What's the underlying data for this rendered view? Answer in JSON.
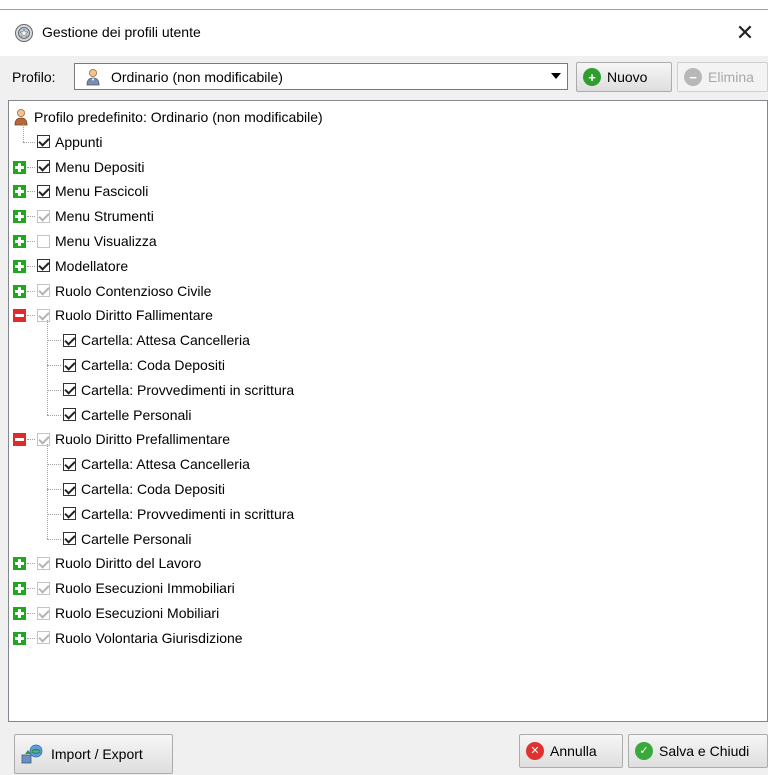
{
  "window": {
    "title": "Gestione dei profili utente",
    "close_glyph": "✕"
  },
  "toolbar": {
    "profile_label": "Profilo:",
    "selected_profile": "Ordinario (non modificabile)",
    "new_label": "Nuovo",
    "delete_label": "Elimina"
  },
  "tree": {
    "root_label": "Profilo predefinito: Ordinario (non modificabile)",
    "items": [
      {
        "label": "Appunti",
        "checked": true,
        "enabled": true,
        "expander": "none"
      },
      {
        "label": "Menu Depositi",
        "checked": true,
        "enabled": true,
        "expander": "plus"
      },
      {
        "label": "Menu Fascicoli",
        "checked": true,
        "enabled": true,
        "expander": "plus"
      },
      {
        "label": "Menu Strumenti",
        "checked": true,
        "enabled": false,
        "expander": "plus"
      },
      {
        "label": "Menu Visualizza",
        "checked": false,
        "enabled": false,
        "expander": "plus"
      },
      {
        "label": "Modellatore",
        "checked": true,
        "enabled": true,
        "expander": "plus"
      },
      {
        "label": "Ruolo Contenzioso Civile",
        "checked": true,
        "enabled": false,
        "expander": "plus"
      },
      {
        "label": "Ruolo Diritto Fallimentare",
        "checked": true,
        "enabled": false,
        "expander": "minus",
        "children": [
          {
            "label": "Cartella: Attesa Cancelleria",
            "checked": true,
            "enabled": true
          },
          {
            "label": "Cartella: Coda Depositi",
            "checked": true,
            "enabled": true
          },
          {
            "label": "Cartella: Provvedimenti in scrittura",
            "checked": true,
            "enabled": true
          },
          {
            "label": "Cartelle Personali",
            "checked": true,
            "enabled": true
          }
        ]
      },
      {
        "label": "Ruolo Diritto Prefallimentare",
        "checked": true,
        "enabled": false,
        "expander": "minus",
        "children": [
          {
            "label": "Cartella: Attesa Cancelleria",
            "checked": true,
            "enabled": true
          },
          {
            "label": "Cartella: Coda Depositi",
            "checked": true,
            "enabled": true
          },
          {
            "label": "Cartella: Provvedimenti in scrittura",
            "checked": true,
            "enabled": true
          },
          {
            "label": "Cartelle Personali",
            "checked": true,
            "enabled": true
          }
        ]
      },
      {
        "label": "Ruolo Diritto del Lavoro",
        "checked": true,
        "enabled": false,
        "expander": "plus"
      },
      {
        "label": "Ruolo Esecuzioni Immobiliari",
        "checked": true,
        "enabled": false,
        "expander": "plus"
      },
      {
        "label": "Ruolo Esecuzioni Mobiliari",
        "checked": true,
        "enabled": false,
        "expander": "plus"
      },
      {
        "label": "Ruolo Volontaria Giurisdizione",
        "checked": true,
        "enabled": false,
        "expander": "plus"
      }
    ]
  },
  "footer": {
    "import_export_label": "Import / Export",
    "cancel_label": "Annulla",
    "save_close_label": "Salva e Chiudi"
  },
  "colors": {
    "expand_plus": "#1fa81f",
    "collapse_minus": "#e12a2a",
    "new_icon": "#2f9e2f",
    "cancel_icon": "#e03030",
    "save_icon": "#3aa83a"
  }
}
